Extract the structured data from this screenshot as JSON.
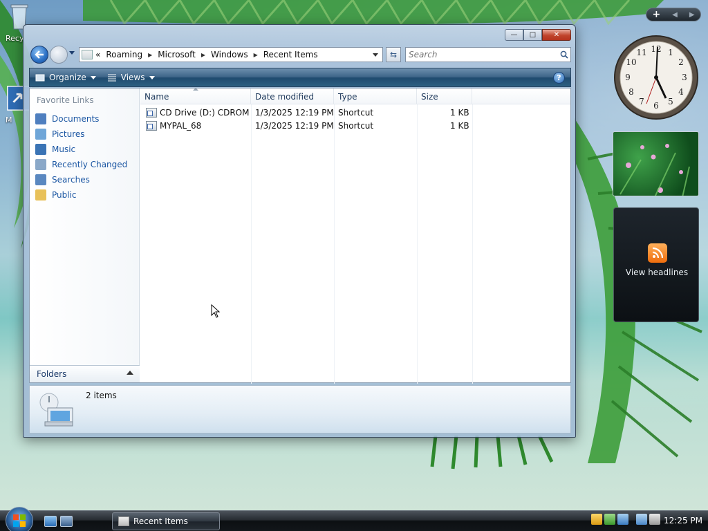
{
  "desktop": {
    "icons": [
      {
        "label": "Recy"
      },
      {
        "label": "M"
      }
    ]
  },
  "window": {
    "title_buttons": {
      "minimize": "—",
      "maximize": "□",
      "close": "✕"
    },
    "address": {
      "overflow": "«",
      "crumbs": [
        "Roaming",
        "Microsoft",
        "Windows",
        "Recent Items"
      ]
    },
    "search": {
      "placeholder": "Search"
    },
    "toolbar": {
      "organize": "Organize",
      "views": "Views",
      "help": "?"
    },
    "nav": {
      "heading": "Favorite Links",
      "items": [
        {
          "label": "Documents",
          "icon": "documents-icon",
          "color": "#4f7fbf"
        },
        {
          "label": "Pictures",
          "icon": "pictures-icon",
          "color": "#6fa6d8"
        },
        {
          "label": "Music",
          "icon": "music-icon",
          "color": "#3a74b5"
        },
        {
          "label": "Recently Changed",
          "icon": "recently-changed-icon",
          "color": "#8aa8c8"
        },
        {
          "label": "Searches",
          "icon": "searches-icon",
          "color": "#5a88c0"
        },
        {
          "label": "Public",
          "icon": "public-folder-icon",
          "color": "#e8c15a"
        }
      ],
      "folders_label": "Folders"
    },
    "columns": [
      "Name",
      "Date modified",
      "Type",
      "Size"
    ],
    "files": [
      {
        "name": "CD Drive (D:) CDROM",
        "date": "1/3/2025 12:19 PM",
        "type": "Shortcut",
        "size": "1 KB"
      },
      {
        "name": "MYPAL_68",
        "date": "1/3/2025 12:19 PM",
        "type": "Shortcut",
        "size": "1 KB"
      }
    ],
    "details": {
      "count": "2 items"
    }
  },
  "sidebar": {
    "controls": {
      "add": "+",
      "prev": "◀",
      "next": "▶"
    },
    "feed": {
      "label": "View headlines"
    }
  },
  "taskbar": {
    "task": {
      "label": "Recent Items"
    },
    "clock": "12:25 PM"
  }
}
